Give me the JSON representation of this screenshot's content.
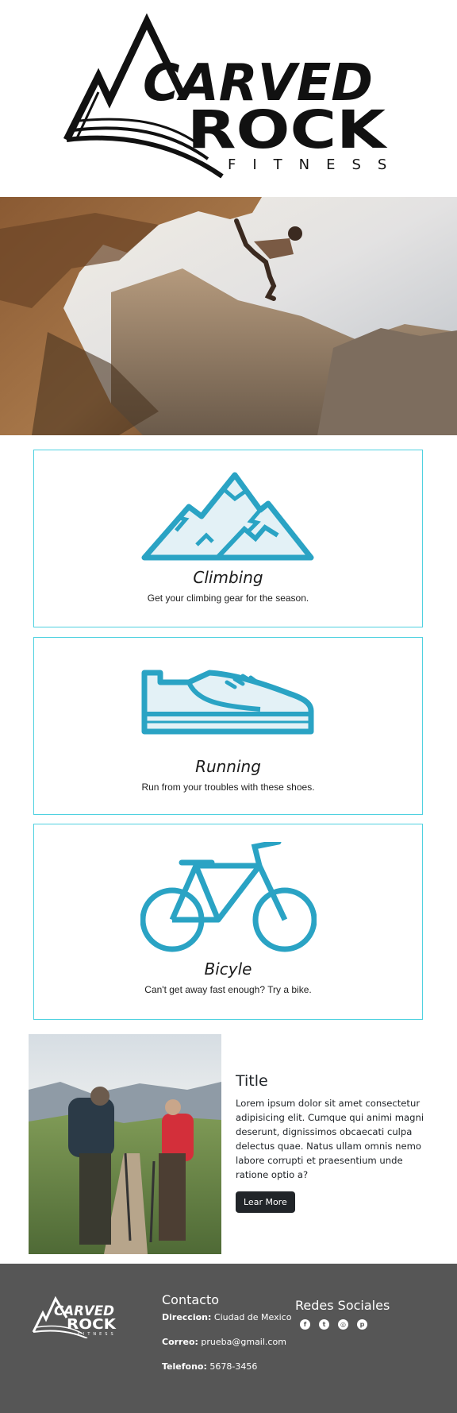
{
  "brand": {
    "logo_word_1": "CARVED",
    "logo_word_2": "ROCK",
    "logo_word_3": "FITNESS",
    "dark": "#111111"
  },
  "colors": {
    "accent": "#2aa3c4",
    "card_border": "#4fd1e0",
    "footer_bg": "#565656",
    "button_bg": "#212529"
  },
  "cards": [
    {
      "title": "Climbing",
      "text": "Get your climbing gear for the season.",
      "icon": "mountains-icon"
    },
    {
      "title": "Running",
      "text": "Run from your troubles with these shoes.",
      "icon": "shoe-icon"
    },
    {
      "title": "Bicyle",
      "text": "Can't get away fast enough? Try a bike.",
      "icon": "bicycle-icon"
    }
  ],
  "feature": {
    "title": "Title",
    "text": "Lorem ipsum dolor sit amet consectetur adipisicing elit. Cumque qui animi magni deserunt, dignissimos obcaecati culpa delectus quae. Natus ullam omnis nemo labore corrupti et praesentium unde ratione optio a?",
    "button": "Lear More"
  },
  "footer": {
    "contact_title": "Contacto",
    "address_label": "Direccion:",
    "address_value": "Ciudad de Mexico",
    "email_label": "Correo:",
    "email_value": "prueba@gmail.com",
    "phone_label": "Telefono:",
    "phone_value": "5678-3456",
    "social_title": "Redes Sociales",
    "social_icons": [
      "facebook-icon",
      "twitter-icon",
      "instagram-icon",
      "pinterest-icon"
    ]
  }
}
